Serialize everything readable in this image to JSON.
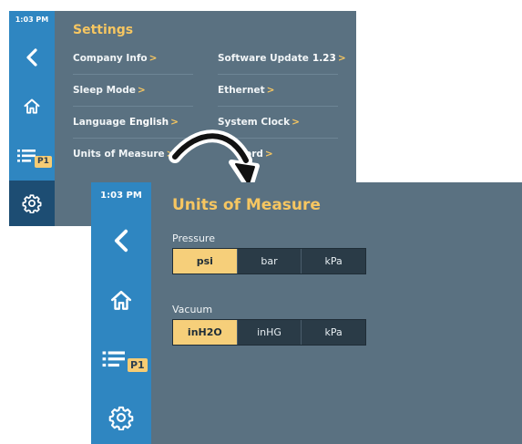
{
  "settings_screen": {
    "time": "1:03 PM",
    "badge": "P1",
    "title": "Settings",
    "items": [
      {
        "label": "Company Info",
        "value": "",
        "chevron": ">"
      },
      {
        "label": "Software Update",
        "value": "1.23",
        "chevron": ">"
      },
      {
        "label": "Sleep Mode",
        "value": "",
        "chevron": ">"
      },
      {
        "label": "Ethernet",
        "value": "",
        "chevron": ">"
      },
      {
        "label": "Language",
        "value": "English",
        "chevron": ">"
      },
      {
        "label": "System Clock",
        "value": "",
        "chevron": ">"
      },
      {
        "label": "Units of Measure",
        "value": "",
        "chevron": ">"
      },
      {
        "label": "ord",
        "value": "",
        "chevron": ">"
      }
    ]
  },
  "uom_screen": {
    "time": "1:03 PM",
    "badge": "P1",
    "title": "Units of Measure",
    "pressure": {
      "label": "Pressure",
      "options": [
        "psi",
        "bar",
        "kPa"
      ],
      "selected": "psi"
    },
    "vacuum": {
      "label": "Vacuum",
      "options": [
        "inH2O",
        "inHG",
        "kPa"
      ],
      "selected": "inH2O"
    }
  },
  "icons": [
    "chevron-left-icon",
    "home-icon",
    "list-icon",
    "gear-icon",
    "curved-arrow-icon"
  ],
  "colors": {
    "sidebar": "#2f86c1",
    "sidebar_active": "#1d4d73",
    "panel": "#5a7181",
    "accent": "#f6c661",
    "selected": "#f6cf7a"
  }
}
